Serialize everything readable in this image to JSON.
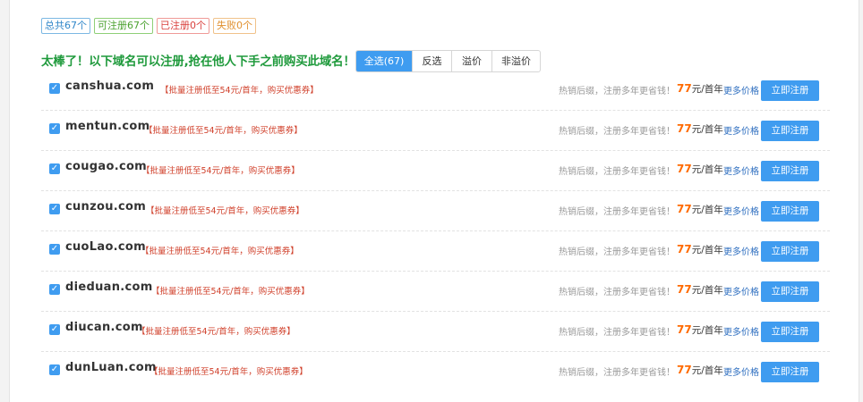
{
  "stats": {
    "total": "总共67个",
    "available": "可注册67个",
    "registered": "已注册0个",
    "failed": "失败0个"
  },
  "headline": "太棒了！以下域名可以注册,抢在他人下手之前购买此域名！",
  "filters": [
    "全选(67)",
    "反选",
    "溢价",
    "非溢价"
  ],
  "rows": [
    {
      "domain": "canshua.com",
      "promo": "【批量注册低至54元/首年，购买优惠券】"
    },
    {
      "domain": "mentun.com",
      "promo": "【批量注册低至54元/首年，购买优惠券】"
    },
    {
      "domain": "cougao.com",
      "promo": "【批量注册低至54元/首年，购买优惠券】"
    },
    {
      "domain": "cunzou.com",
      "promo": "【批量注册低至54元/首年，购买优惠券】"
    },
    {
      "domain": "cuoLao.com",
      "promo": "【批量注册低至54元/首年，购买优惠券】"
    },
    {
      "domain": "dieduan.com",
      "promo": "【批量注册低至54元/首年，购买优惠券】"
    },
    {
      "domain": "diucan.com",
      "promo": "【批量注册低至54元/首年，购买优惠券】"
    },
    {
      "domain": "dunLuan.com",
      "promo": "【批量注册低至54元/首年，购买优惠券】"
    }
  ],
  "row_common": {
    "hint": "热销后缀，注册多年更省钱！",
    "price": "77",
    "price_unit": "元/首年",
    "more_prices": "更多价格",
    "register": "立即注册",
    "checked": true
  },
  "colors": {
    "accent": "#3f9cf0",
    "headline": "#1f9a3c",
    "promo": "#d0402b",
    "price": "#ff6a00"
  }
}
